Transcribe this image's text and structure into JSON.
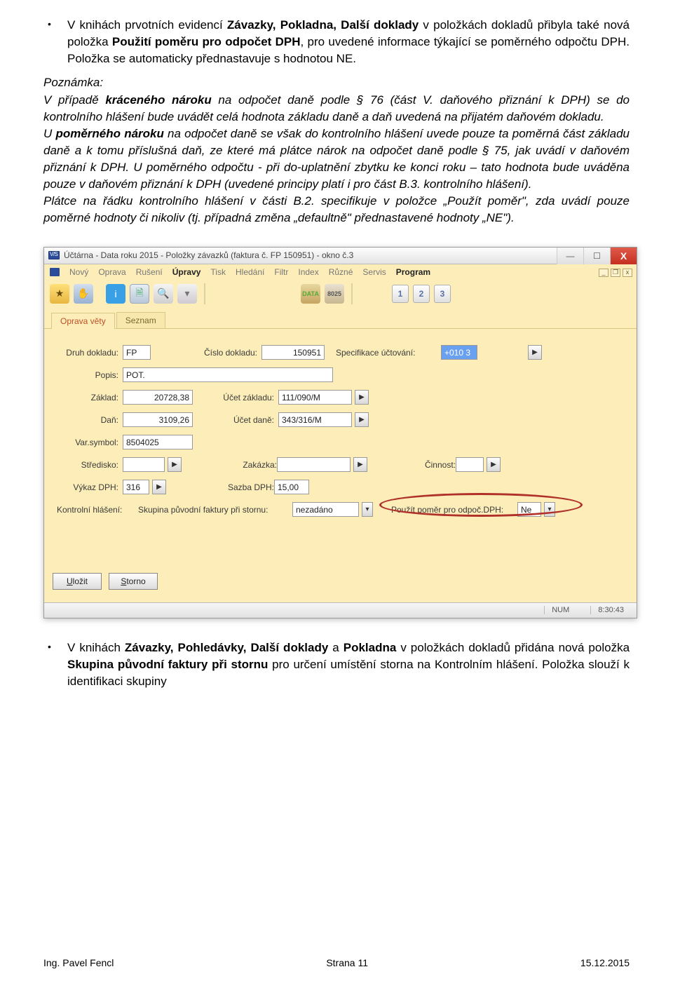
{
  "bullet1": {
    "pre": "V knihách prvotních evidencí ",
    "b1": "Závazky, Pokladna, Další doklady",
    "mid1": " v položkách dokladů přibyla také nová položka ",
    "b2": "Použití poměru pro odpočet DPH",
    "post": ", pro uvedené informace týkající se poměrného odpočtu DPH. Položka se automaticky přednastavuje s hodnotou NE."
  },
  "note": {
    "p1a": "Poznámka:",
    "p1b": "V případě ",
    "p1c": "kráceného nároku",
    "p1d": " na odpočet daně podle § 76 (část V. daňového přiznání k DPH) se do kontrolního hlášení bude uvádět celá hodnota základu daně a daň uvedená na přijatém daňovém dokladu.",
    "p2a": "U ",
    "p2b": "poměrného nároku",
    "p2c": " na odpočet daně se však do kontrolního hlášení uvede pouze ta poměrná část základu daně a k tomu příslušná daň, ze které má plátce nárok na odpočet daně podle § 75, jak uvádí v daňovém přiznání k DPH. U poměrného odpočtu - při do-uplatnění zbytku ke konci roku – tato hodnota bude uváděna pouze v daňovém přiznání k DPH (uvedené principy platí i pro část B.3. kontrolního hlášení).",
    "p3": "Plátce na řádku kontrolního hlášení v části B.2. specifikuje v položce „Použít poměr\", zda uvádí pouze poměrné hodnoty či nikoliv (tj. případná změna „defaultně\" přednastavené hodnoty „NE\")."
  },
  "window": {
    "title": "Účtárna - Data roku 2015 - Položky závazků (faktura č. FP      150951) - okno č.3",
    "menu": [
      "Nový",
      "Oprava",
      "Rušení",
      "Úpravy",
      "Tisk",
      "Hledání",
      "Filtr",
      "Index",
      "Různé",
      "Servis",
      "Program"
    ],
    "menu_bold": [
      3,
      10
    ],
    "tabs": {
      "active": "Oprava věty",
      "other": "Seznam"
    },
    "nums": [
      "1",
      "2",
      "3"
    ],
    "form": {
      "druh_label": "Druh dokladu:",
      "druh": "FP",
      "cislo_label": "Číslo dokladu:",
      "cislo": "150951",
      "spec_label": "Specifikace účtování:",
      "spec": "+010 3",
      "popis_label": "Popis:",
      "popis": "POT.",
      "zaklad_label": "Základ:",
      "zaklad": "20728,38",
      "ucetz_label": "Účet základu:",
      "ucetz": "111/090/M",
      "dan_label": "Daň:",
      "dan": "3109,26",
      "ucetd_label": "Účet daně:",
      "ucetd": "343/316/M",
      "vars_label": "Var.symbol:",
      "vars": "8504025",
      "stred_label": "Středisko:",
      "zak_label": "Zakázka:",
      "cinn_label": "Činnost:",
      "vykaz_label": "Výkaz DPH:",
      "vykaz": "316",
      "sazba_label": "Sazba DPH:",
      "sazba": "15,00",
      "kh_label": "Kontrolní hlášení:",
      "storno_label": "Skupina původní faktury při stornu:",
      "storno": "nezadáno",
      "pomer_label": "Použít poměr pro odpoč.DPH:",
      "pomer": "Ne"
    },
    "buttons": {
      "ulozit": "Uložit",
      "storno": "Storno"
    },
    "status": {
      "num": "NUM",
      "time": "8:30:43"
    }
  },
  "bullet2": {
    "pre": "V knihách ",
    "b1": "Závazky, Pohledávky, Další doklady",
    "mid1": " a ",
    "b2": "Pokladna",
    "mid2": " v položkách dokladů přidána nová položka ",
    "b3": "Skupina původní faktury při stornu",
    "post": " pro určení umístění storna na Kontrolním hlášení. Položka slouží k identifikaci skupiny"
  },
  "footer": {
    "left": "Ing. Pavel Fencl",
    "center": "Strana 11",
    "right": "15.12.2015"
  }
}
